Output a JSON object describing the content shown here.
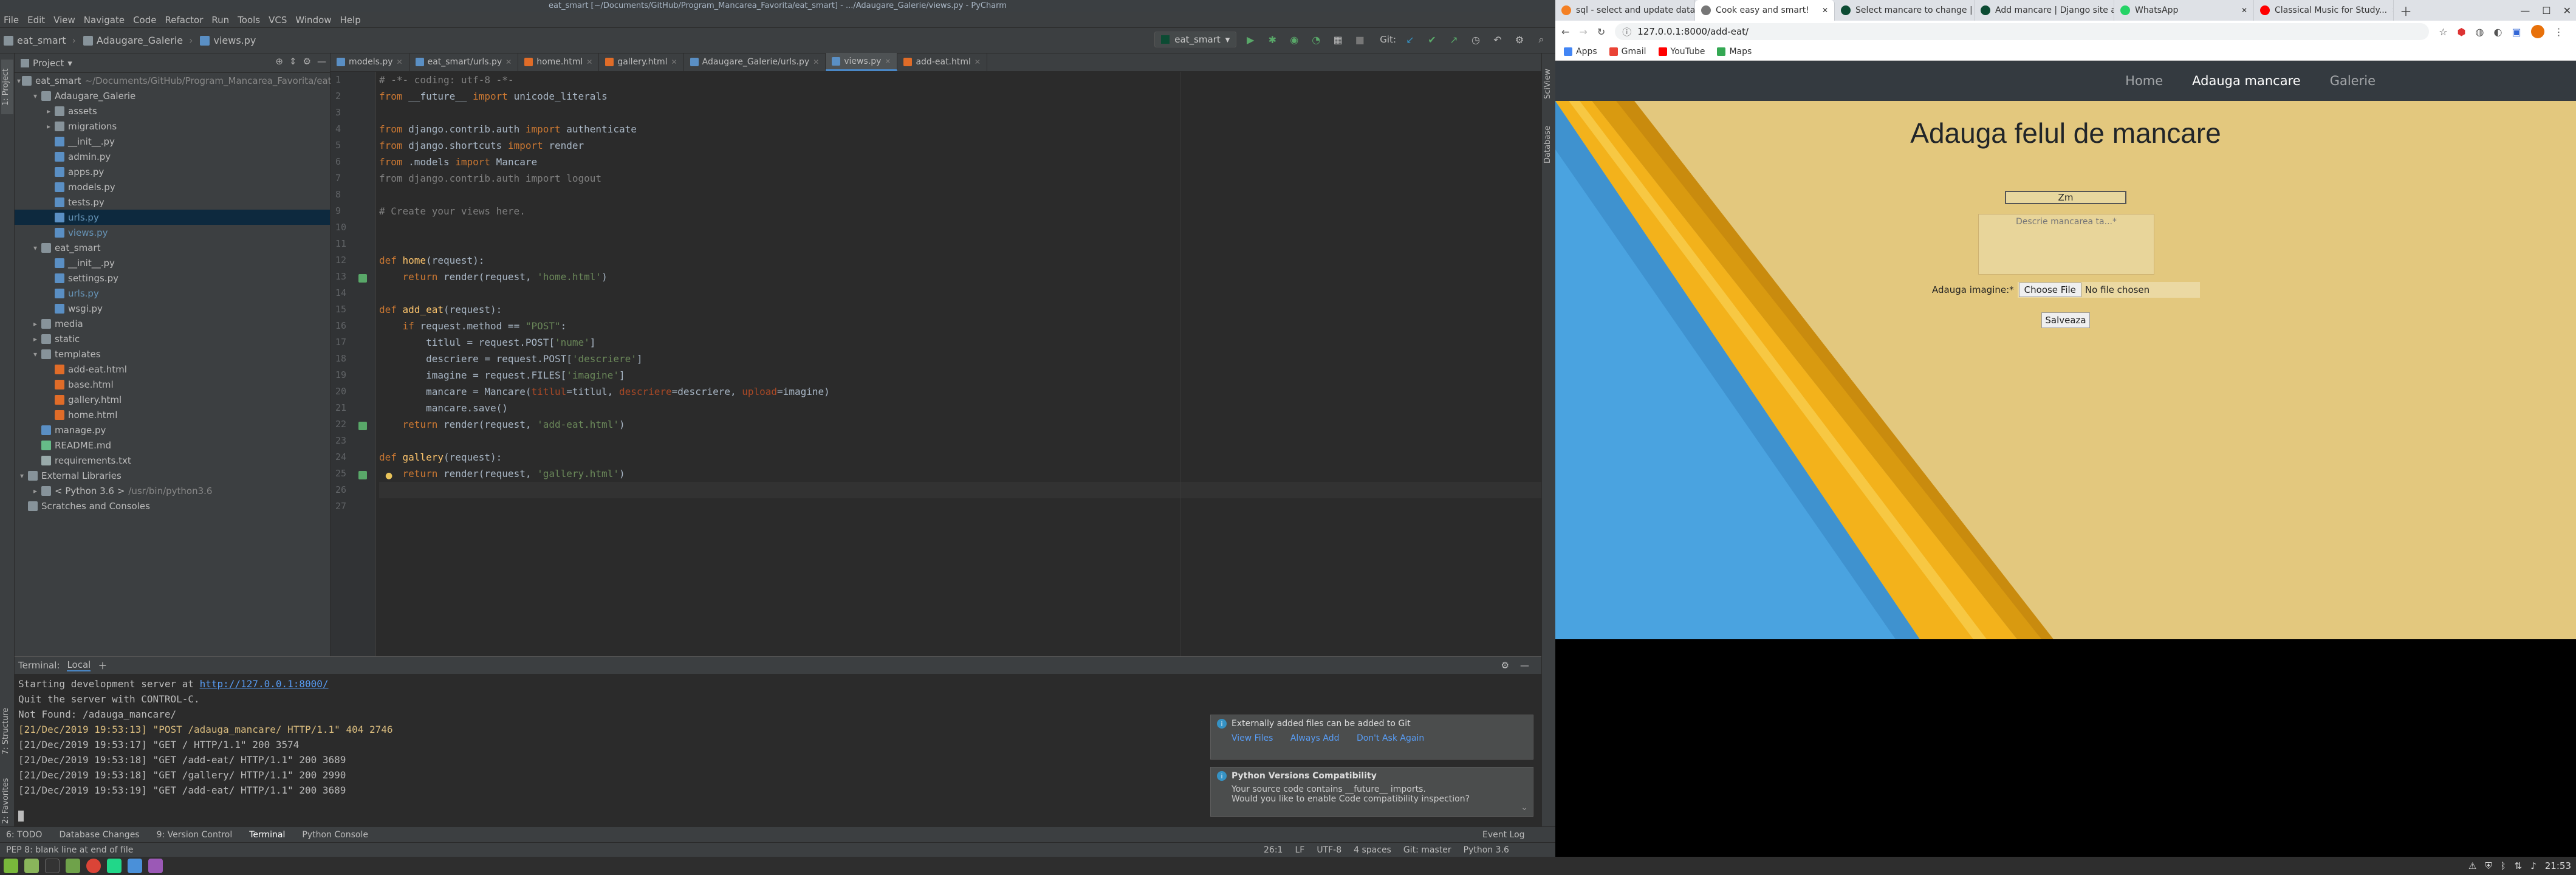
{
  "ide": {
    "window_title": "eat_smart [~/Documents/GitHub/Program_Mancarea_Favorita/eat_smart] - .../Adaugare_Galerie/views.py - PyCharm",
    "menu": [
      "File",
      "Edit",
      "View",
      "Navigate",
      "Code",
      "Refactor",
      "Run",
      "Tools",
      "VCS",
      "Window",
      "Help"
    ],
    "breadcrumb": [
      "eat_smart",
      "Adaugare_Galerie",
      "views.py"
    ],
    "run_config": "eat_smart",
    "git_label": "Git:",
    "project_panel": {
      "title": "Project",
      "tree": [
        {
          "label": "eat_smart",
          "path": "~/Documents/GitHub/Program_Mancarea_Favorita/eat_smart",
          "indent": 0,
          "arrow": "▾",
          "type": "fold"
        },
        {
          "label": "Adaugare_Galerie",
          "indent": 1,
          "arrow": "▾",
          "type": "fold"
        },
        {
          "label": "assets",
          "indent": 2,
          "arrow": "▸",
          "type": "fold"
        },
        {
          "label": "migrations",
          "indent": 2,
          "arrow": "▸",
          "type": "fold"
        },
        {
          "label": "__init__.py",
          "indent": 2,
          "arrow": "",
          "type": "py"
        },
        {
          "label": "admin.py",
          "indent": 2,
          "arrow": "",
          "type": "py"
        },
        {
          "label": "apps.py",
          "indent": 2,
          "arrow": "",
          "type": "py"
        },
        {
          "label": "models.py",
          "indent": 2,
          "arrow": "",
          "type": "py"
        },
        {
          "label": "tests.py",
          "indent": 2,
          "arrow": "",
          "type": "py"
        },
        {
          "label": "urls.py",
          "indent": 2,
          "arrow": "",
          "type": "py",
          "selected": true
        },
        {
          "label": "views.py",
          "indent": 2,
          "arrow": "",
          "type": "py"
        },
        {
          "label": "eat_smart",
          "indent": 1,
          "arrow": "▾",
          "type": "fold"
        },
        {
          "label": "__init__.py",
          "indent": 2,
          "arrow": "",
          "type": "py"
        },
        {
          "label": "settings.py",
          "indent": 2,
          "arrow": "",
          "type": "py"
        },
        {
          "label": "urls.py",
          "indent": 2,
          "arrow": "",
          "type": "py"
        },
        {
          "label": "wsgi.py",
          "indent": 2,
          "arrow": "",
          "type": "py"
        },
        {
          "label": "media",
          "indent": 1,
          "arrow": "▸",
          "type": "fold"
        },
        {
          "label": "static",
          "indent": 1,
          "arrow": "▸",
          "type": "fold"
        },
        {
          "label": "templates",
          "indent": 1,
          "arrow": "▾",
          "type": "fold"
        },
        {
          "label": "add-eat.html",
          "indent": 2,
          "arrow": "",
          "type": "html"
        },
        {
          "label": "base.html",
          "indent": 2,
          "arrow": "",
          "type": "html"
        },
        {
          "label": "gallery.html",
          "indent": 2,
          "arrow": "",
          "type": "html"
        },
        {
          "label": "home.html",
          "indent": 2,
          "arrow": "",
          "type": "html"
        },
        {
          "label": "manage.py",
          "indent": 1,
          "arrow": "",
          "type": "py"
        },
        {
          "label": "README.md",
          "indent": 1,
          "arrow": "",
          "type": "md"
        },
        {
          "label": "requirements.txt",
          "indent": 1,
          "arrow": "",
          "type": "txt"
        },
        {
          "label": "External Libraries",
          "indent": 0,
          "arrow": "▾",
          "type": "fold"
        },
        {
          "label": "< Python 3.6 >",
          "path": "/usr/bin/python3.6",
          "indent": 1,
          "arrow": "▸",
          "type": "fold"
        },
        {
          "label": "Scratches and Consoles",
          "indent": 0,
          "arrow": "",
          "type": "fold"
        }
      ]
    },
    "editor_tabs": [
      {
        "label": "models.py",
        "type": "py"
      },
      {
        "label": "eat_smart/urls.py",
        "type": "py"
      },
      {
        "label": "home.html",
        "type": "html"
      },
      {
        "label": "gallery.html",
        "type": "html"
      },
      {
        "label": "Adaugare_Galerie/urls.py",
        "type": "py"
      },
      {
        "label": "views.py",
        "type": "py",
        "active": true
      },
      {
        "label": "add-eat.html",
        "type": "html"
      }
    ],
    "code_lines": [
      [
        [
          "# -*- coding: utf-8 -*-",
          "#808080"
        ]
      ],
      [
        [
          "from ",
          "#cc7832"
        ],
        [
          "__future__ ",
          "#a9b7c6"
        ],
        [
          "import ",
          "#cc7832"
        ],
        [
          "unicode_literals",
          "#a9b7c6"
        ]
      ],
      [],
      [
        [
          "from ",
          "#cc7832"
        ],
        [
          "django",
          "#a9b7c6"
        ],
        [
          ".contrib.auth ",
          "#a9b7c6"
        ],
        [
          "import ",
          "#cc7832"
        ],
        [
          "authenticate",
          "#a9b7c6"
        ]
      ],
      [
        [
          "from ",
          "#cc7832"
        ],
        [
          "django",
          "#a9b7c6"
        ],
        [
          ".shortcuts ",
          "#a9b7c6"
        ],
        [
          "import ",
          "#cc7832"
        ],
        [
          "render",
          "#a9b7c6"
        ]
      ],
      [
        [
          "from ",
          "#cc7832"
        ],
        [
          ".models ",
          "#a9b7c6"
        ],
        [
          "import ",
          "#cc7832"
        ],
        [
          "Mancare",
          "#a9b7c6"
        ]
      ],
      [
        [
          "from django.contrib.auth import logout",
          "#808080"
        ]
      ],
      [],
      [
        [
          "# Create your views here.",
          "#808080"
        ]
      ],
      [],
      [],
      [
        [
          "def ",
          "#cc7832"
        ],
        [
          "home",
          "#ffc66d"
        ],
        [
          "(request):",
          "#a9b7c6"
        ]
      ],
      [
        [
          "    return ",
          "#cc7832"
        ],
        [
          "render(request, ",
          "#a9b7c6"
        ],
        [
          "'home.html'",
          "#6a8759"
        ],
        [
          ")",
          "#a9b7c6"
        ]
      ],
      [],
      [
        [
          "def ",
          "#cc7832"
        ],
        [
          "add_eat",
          "#ffc66d"
        ],
        [
          "(request):",
          "#a9b7c6"
        ]
      ],
      [
        [
          "    if ",
          "#cc7832"
        ],
        [
          "request.method == ",
          "#a9b7c6"
        ],
        [
          "\"POST\"",
          "#6a8759"
        ],
        [
          ":",
          "#a9b7c6"
        ]
      ],
      [
        [
          "        titlul = request.POST[",
          "#a9b7c6"
        ],
        [
          "'nume'",
          "#6a8759"
        ],
        [
          "]",
          "#a9b7c6"
        ]
      ],
      [
        [
          "        descriere = request.POST[",
          "#a9b7c6"
        ],
        [
          "'descriere'",
          "#6a8759"
        ],
        [
          "]",
          "#a9b7c6"
        ]
      ],
      [
        [
          "        imagine = request.FILES[",
          "#a9b7c6"
        ],
        [
          "'imagine'",
          "#6a8759"
        ],
        [
          "]",
          "#a9b7c6"
        ]
      ],
      [
        [
          "        mancare = Mancare(",
          "#a9b7c6"
        ],
        [
          "titlul",
          "#aa4926"
        ],
        [
          "=titlul, ",
          "#a9b7c6"
        ],
        [
          "descriere",
          "#aa4926"
        ],
        [
          "=descriere, ",
          "#a9b7c6"
        ],
        [
          "upload",
          "#aa4926"
        ],
        [
          "=imagine)",
          "#a9b7c6"
        ]
      ],
      [
        [
          "        mancare.save()",
          "#a9b7c6"
        ]
      ],
      [
        [
          "    return ",
          "#cc7832"
        ],
        [
          "render(request, ",
          "#a9b7c6"
        ],
        [
          "'add-eat.html'",
          "#6a8759"
        ],
        [
          ")",
          "#a9b7c6"
        ]
      ],
      [],
      [
        [
          "def ",
          "#cc7832"
        ],
        [
          "gallery",
          "#ffc66d"
        ],
        [
          "(request):",
          "#a9b7c6"
        ]
      ],
      [
        [
          "    return ",
          "#cc7832"
        ],
        [
          "render(request, ",
          "#a9b7c6"
        ],
        [
          "'gallery.html'",
          "#6a8759"
        ],
        [
          ")",
          "#a9b7c6"
        ]
      ],
      [],
      []
    ],
    "terminal": {
      "label": "Terminal:",
      "tab": "Local",
      "lines": [
        {
          "text": "Starting development server at ",
          "url": "http://127.0.0.1:8000/"
        },
        {
          "text": "Quit the server with CONTROL-C."
        },
        {
          "text": "Not Found: /adauga_mancare/"
        },
        {
          "text": "[21/Dec/2019 19:53:13] \"POST /adauga_mancare/ HTTP/1.1\" 404 2746",
          "warn": true
        },
        {
          "text": "[21/Dec/2019 19:53:17] \"GET / HTTP/1.1\" 200 3574"
        },
        {
          "text": "[21/Dec/2019 19:53:18] \"GET /add-eat/ HTTP/1.1\" 200 3689"
        },
        {
          "text": "[21/Dec/2019 19:53:18] \"GET /gallery/ HTTP/1.1\" 200 2990"
        },
        {
          "text": "[21/Dec/2019 19:53:19] \"GET /add-eat/ HTTP/1.1\" 200 3689"
        }
      ]
    },
    "notifications": [
      {
        "title": "Externally added files can be added to Git",
        "links": [
          "View Files",
          "Always Add",
          "Don't Ask Again"
        ]
      },
      {
        "title": "Python Versions Compatibility",
        "body": [
          "Your source code contains __future__ imports.",
          "Would you like to enable Code compatibility inspection?"
        ]
      }
    ],
    "bottom_tabs": [
      "6: TODO",
      "Database Changes",
      "9: Version Control",
      "Terminal",
      "Python Console"
    ],
    "event_log": "Event Log",
    "status_message": "PEP 8: blank line at end of file",
    "status_right": [
      "26:1",
      "LF",
      "UTF-8",
      "4 spaces",
      "Git: master",
      "Python 3.6"
    ],
    "side_tools": [
      "1: Project",
      "7: Structure",
      "2: Favorites",
      "SciView",
      "Database"
    ]
  },
  "browser": {
    "tabs": [
      {
        "label": "sql - select and update datab...",
        "color": "#f48024"
      },
      {
        "label": "Cook easy and smart!",
        "color": "#777",
        "active": true
      },
      {
        "label": "Select mancare to change | Dj...",
        "color": "#0c4b33"
      },
      {
        "label": "Add mancare | Django site adm...",
        "color": "#0c4b33"
      },
      {
        "label": "WhatsApp",
        "color": "#25d366"
      },
      {
        "label": "Classical Music for Study...",
        "color": "#ff0000"
      }
    ],
    "url": "127.0.0.1:8000/add-eat/",
    "bookmarks": [
      {
        "label": "Apps",
        "color": "#4285f4"
      },
      {
        "label": "Gmail",
        "color": "#ea4335"
      },
      {
        "label": "YouTube",
        "color": "#ff0000"
      },
      {
        "label": "Maps",
        "color": "#34a853"
      }
    ],
    "page": {
      "nav": [
        "Home",
        "Adauga mancare",
        "Galerie"
      ],
      "nav_active": 1,
      "heading": "Adauga felul de mancare",
      "title_value": "Zm",
      "desc_placeholder": "Descrie mancarea ta...*",
      "image_label": "Adauga imagine:*",
      "choose_file": "Choose File",
      "no_file": "No file chosen",
      "save": "Salveaza"
    }
  },
  "taskbar": {
    "clock": "21:53"
  }
}
